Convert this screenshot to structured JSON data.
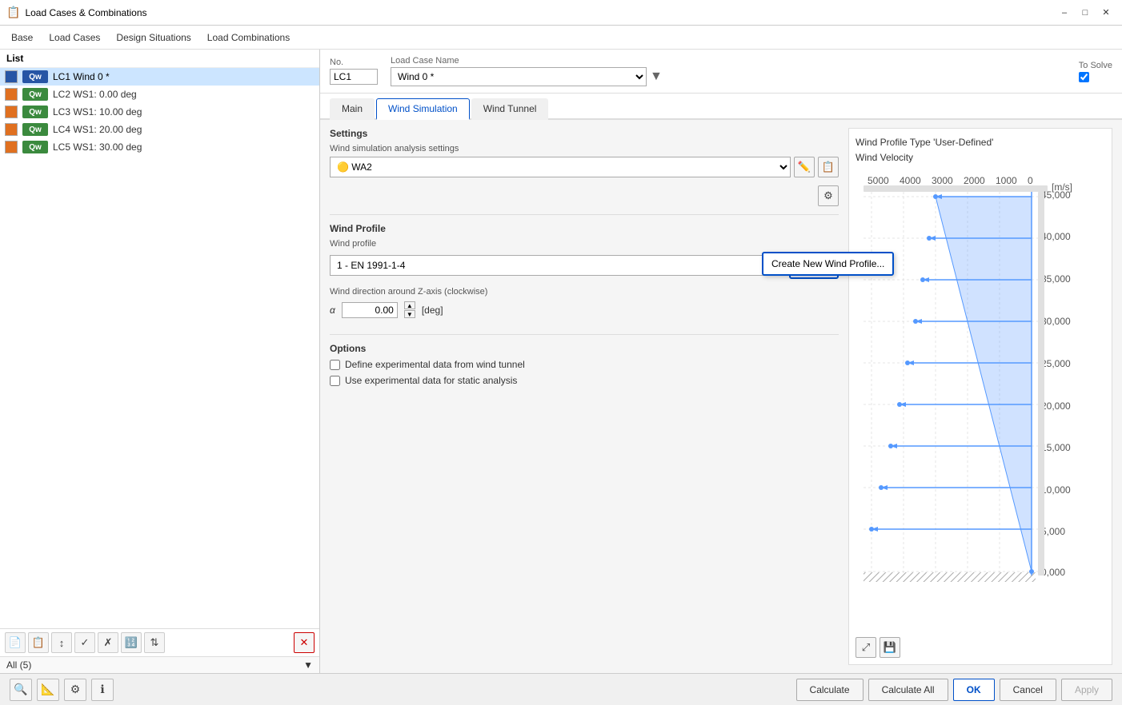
{
  "window": {
    "title": "Load Cases & Combinations",
    "icon": "📋"
  },
  "menu": {
    "items": [
      "Base",
      "Load Cases",
      "Design Situations",
      "Load Combinations"
    ],
    "active_index": 0
  },
  "left_panel": {
    "header": "List",
    "items": [
      {
        "id": "LC1",
        "badge": "Qw",
        "badge_color": "blue",
        "label": "LC1  Wind 0 *",
        "color": "blue",
        "selected": true
      },
      {
        "id": "LC2",
        "badge": "Qw",
        "badge_color": "green",
        "label": "LC2  WS1: 0.00 deg",
        "color": "orange",
        "selected": false
      },
      {
        "id": "LC3",
        "badge": "Qw",
        "badge_color": "green",
        "label": "LC3  WS1: 10.00 deg",
        "color": "orange",
        "selected": false
      },
      {
        "id": "LC4",
        "badge": "Qw",
        "badge_color": "green",
        "label": "LC4  WS1: 20.00 deg",
        "color": "orange",
        "selected": false
      },
      {
        "id": "LC5",
        "badge": "Qw",
        "badge_color": "green",
        "label": "LC5  WS1: 30.00 deg",
        "color": "orange",
        "selected": false
      }
    ],
    "footer": {
      "filter": "All (5)"
    },
    "toolbar_buttons": [
      "new",
      "copy",
      "move-up",
      "check-all",
      "check-none",
      "renumber",
      "sort",
      "delete"
    ]
  },
  "header": {
    "no_label": "No.",
    "no_value": "LC1",
    "name_label": "Load Case Name",
    "name_value": "Wind 0 *",
    "to_solve_label": "To Solve",
    "to_solve_checked": true
  },
  "tabs": {
    "items": [
      "Main",
      "Wind Simulation",
      "Wind Tunnel"
    ],
    "active": "Wind Simulation"
  },
  "wind_simulation": {
    "settings_label": "Settings",
    "analysis_label": "Wind simulation analysis settings",
    "analysis_value": "WA2",
    "wind_profile_section": "Wind Profile",
    "wind_profile_label": "Wind profile",
    "wind_profile_value": "1 - EN 1991-1-4",
    "wind_direction_label": "Wind direction around Z-axis (clockwise)",
    "alpha_label": "α",
    "alpha_value": "0.00",
    "alpha_unit": "[deg]",
    "create_new_label": "Create New Wind Profile...",
    "options_label": "Options",
    "option1": "Define experimental data from wind tunnel",
    "option2": "Use experimental data for static analysis"
  },
  "chart": {
    "title_line1": "Wind Profile Type 'User-Defined'",
    "title_line2": "Wind Velocity",
    "x_unit": "[m/s]",
    "y_values": [
      "45,000",
      "40,000",
      "35,000",
      "30,000",
      "25,000",
      "20,000",
      "15,000",
      "10,000",
      "5,000",
      "0,000"
    ],
    "x_ticks": [
      "5000",
      "4000",
      "3000",
      "2000",
      "1000",
      "0"
    ]
  },
  "bottom_bar": {
    "calculate_label": "Calculate",
    "calculate_all_label": "Calculate All",
    "ok_label": "OK",
    "cancel_label": "Cancel",
    "apply_label": "Apply"
  }
}
